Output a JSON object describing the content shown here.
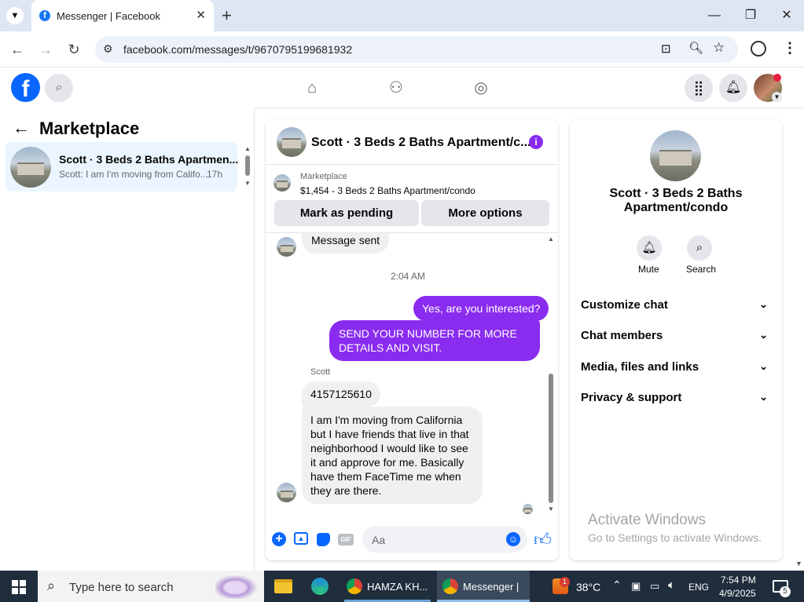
{
  "browser": {
    "tab_title": "Messenger | Facebook",
    "url": "facebook.com/messages/t/9670795199681932"
  },
  "left_panel": {
    "title": "Marketplace",
    "conversation": {
      "name": "Scott · 3 Beds 2 Baths Apartmen...",
      "preview": "Scott: I am I'm moving from Califo...",
      "time": "17h"
    }
  },
  "chat": {
    "header_name": "Scott · 3 Beds 2 Baths Apartment/c...",
    "listing_source": "Marketplace",
    "listing_price_title": "$1,454 - 3 Beds 2 Baths Apartment/condo",
    "mark_pending_label": "Mark as pending",
    "more_options_label": "More options",
    "msg_sent": "Message sent",
    "timestamp": "2:04 AM",
    "out_msg_1": "Yes, are you interested?",
    "out_msg_2": "SEND YOUR NUMBER FOR MORE DETAILS AND VISIT.",
    "sender_name": "Scott",
    "in_msg_1": "4157125610",
    "in_msg_2": "I am I'm moving from California but I have friends that live in that neighborhood I would like to see it and approve for me. Basically have them FaceTime me when they are there.",
    "composer_placeholder": "Aa",
    "gif_label": "GIF"
  },
  "info_panel": {
    "name": "Scott · 3 Beds 2 Baths Apartment/condo",
    "mute_label": "Mute",
    "search_label": "Search",
    "sections": [
      "Customize chat",
      "Chat members",
      "Media, files and links",
      "Privacy & support"
    ]
  },
  "watermark": {
    "title": "Activate Windows",
    "subtitle": "Go to Settings to activate Windows."
  },
  "taskbar": {
    "search_placeholder": "Type here to search",
    "app1": "HAMZA KH...",
    "app2": "Messenger | ...",
    "weather": "38°C",
    "weather_badge": "1",
    "lang": "ENG",
    "time": "7:54 PM",
    "date": "4/9/2025",
    "notif_count": "5"
  },
  "colors": {
    "fb_blue": "#0866ff",
    "outgoing_bubble": "#8a2cf0",
    "selected_row": "#ebf5ff"
  }
}
